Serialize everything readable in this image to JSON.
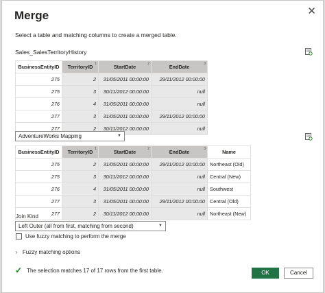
{
  "dialog": {
    "title": "Merge",
    "close_glyph": "✕",
    "description": "Select a table and matching columns to create a merged table."
  },
  "first_table": {
    "name": "Sales_SalesTerritoryHistory",
    "preview_icon": "table-preview-icon",
    "columns": [
      {
        "label": "BusinessEntityID",
        "num": ""
      },
      {
        "label": "TerritoryID",
        "num": "1"
      },
      {
        "label": "StartDate",
        "num": "2"
      },
      {
        "label": "EndDate",
        "num": "3"
      }
    ],
    "rows": [
      [
        "275",
        "2",
        "31/05/2011 00:00:00",
        "29/11/2012 00:00:00"
      ],
      [
        "275",
        "3",
        "30/11/2012 00:00:00",
        "null"
      ],
      [
        "276",
        "4",
        "31/05/2011 00:00:00",
        "null"
      ],
      [
        "277",
        "3",
        "31/05/2011 00:00:00",
        "29/11/2012 00:00:00"
      ],
      [
        "277",
        "2",
        "30/11/2012 00:00:00",
        "null"
      ]
    ]
  },
  "second_table": {
    "selected": "AdventureWorks Mapping",
    "dropdown_caret": "▼",
    "preview_icon": "table-preview-icon",
    "columns": [
      {
        "label": "BusinessEntityID",
        "num": ""
      },
      {
        "label": "TerritoryID",
        "num": "1"
      },
      {
        "label": "StartDate",
        "num": "2"
      },
      {
        "label": "EndDate",
        "num": "3"
      },
      {
        "label": "Name",
        "num": ""
      }
    ],
    "rows": [
      [
        "275",
        "2",
        "31/05/2011 00:00:00",
        "29/11/2012 00:00:00",
        "Northeast (Old)"
      ],
      [
        "275",
        "3",
        "30/11/2012 00:00:00",
        "null",
        "Central (New)"
      ],
      [
        "276",
        "4",
        "31/05/2011 00:00:00",
        "null",
        "Southwest"
      ],
      [
        "277",
        "3",
        "31/05/2011 00:00:00",
        "29/11/2012 00:00:00",
        "Central (Old)"
      ],
      [
        "277",
        "2",
        "30/11/2012 00:00:00",
        "null",
        "Northeast (New)"
      ]
    ]
  },
  "join": {
    "label": "Join Kind",
    "selected": "Left Outer (all from first, matching from second)",
    "dropdown_caret": "▼"
  },
  "fuzzy": {
    "checkbox_label": "Use fuzzy matching to perform the merge",
    "checked": false,
    "options_label": "Fuzzy matching options",
    "chevron": "›"
  },
  "status": {
    "icon": "check-icon",
    "glyph": "✓",
    "text": "The selection matches 17 of 17 rows from the first table."
  },
  "buttons": {
    "ok": "OK",
    "cancel": "Cancel"
  },
  "colors": {
    "accent": "#217346",
    "selected_column": "#c8c6c4",
    "success": "#107c10"
  }
}
